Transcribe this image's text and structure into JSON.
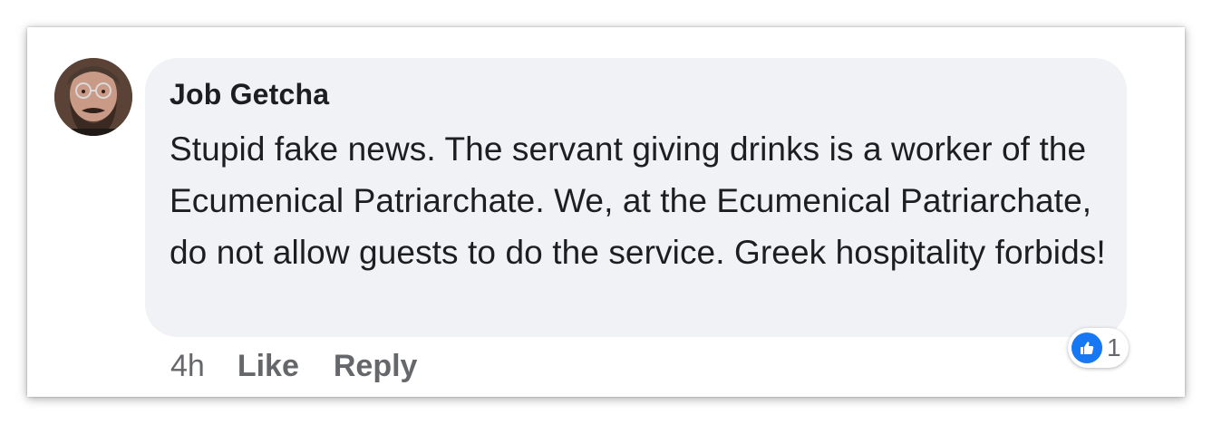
{
  "comment": {
    "author": "Job Getcha",
    "text": "Stupid fake news. The servant giving drinks is a worker of the Ecumenical Patriarchate. We, at the Ecumenical Patriarchate, do not allow guests to do the service. Greek hospitality forbids!",
    "avatar_icon": "profile-photo",
    "bubble_color": "#f0f2f5"
  },
  "actions": {
    "time": "4h",
    "like_label": "Like",
    "reply_label": "Reply"
  },
  "reactions": {
    "icon": "thumbs-up-icon",
    "count": "1",
    "color": "#1877f2"
  }
}
